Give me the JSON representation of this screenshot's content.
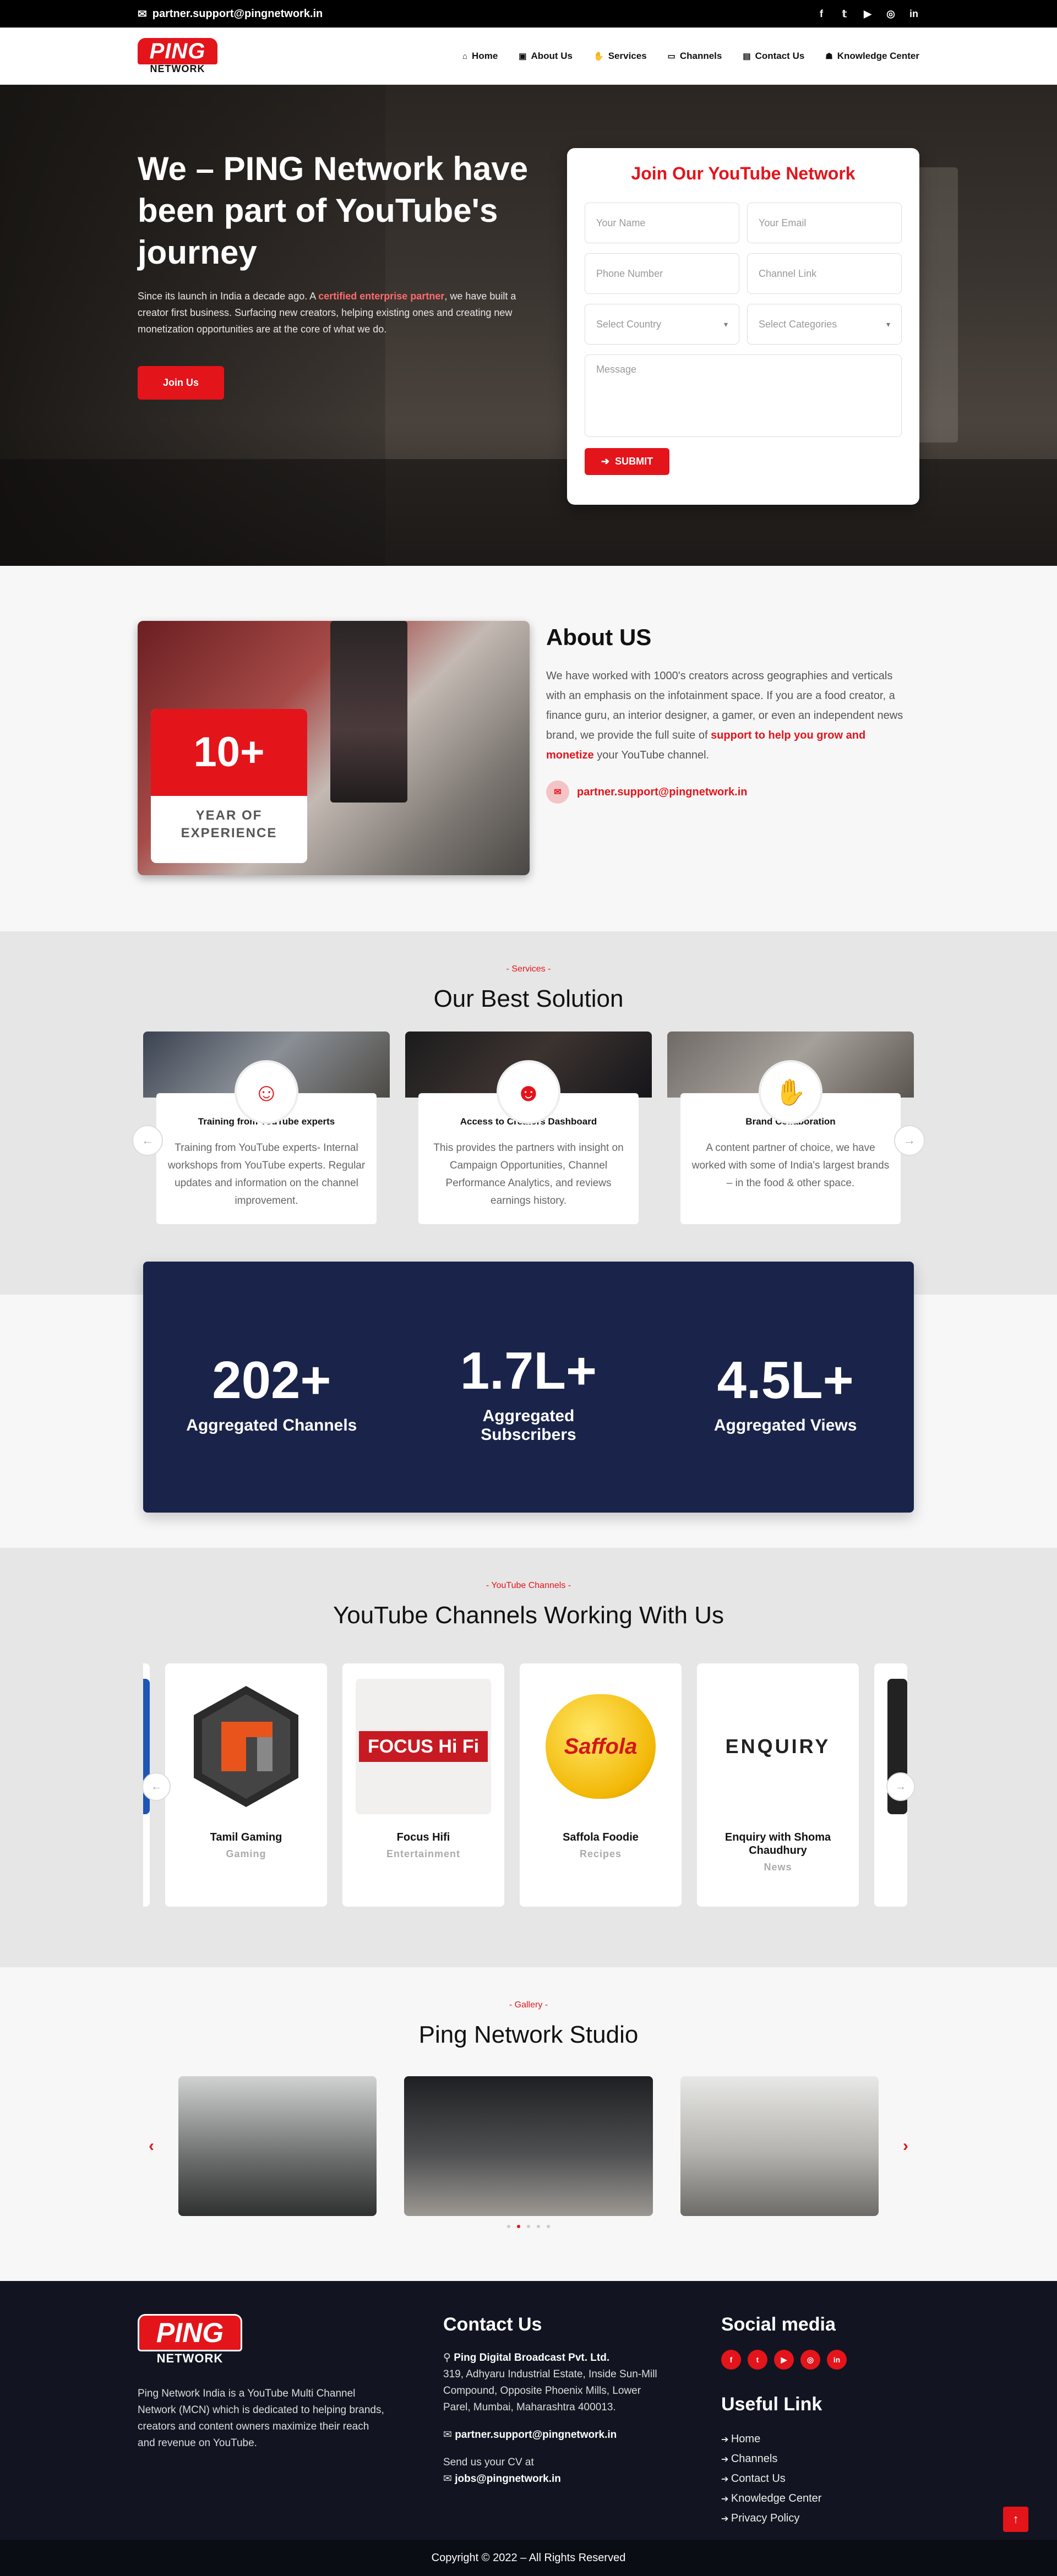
{
  "topbar": {
    "email": "partner.support@pingnetwork.in",
    "social": [
      "f",
      "t",
      "yt",
      "ig",
      "in"
    ]
  },
  "brand": {
    "logo_top": "PING",
    "logo_bottom": "NETWORK",
    "accent": "#e4141b",
    "navy": "#1a2349"
  },
  "nav": {
    "items": [
      {
        "label": "Home",
        "icon": "home-icon"
      },
      {
        "label": "About Us",
        "icon": "id-badge-icon"
      },
      {
        "label": "Services",
        "icon": "handshake-icon"
      },
      {
        "label": "Channels",
        "icon": "monitor-icon"
      },
      {
        "label": "Contact Us",
        "icon": "contact-card-icon"
      },
      {
        "label": "Knowledge Center",
        "icon": "book-user-icon"
      }
    ]
  },
  "hero": {
    "title": "We – PING Network have been part of YouTube's journey",
    "text_before": "Since its launch in India a decade ago. A ",
    "text_highlight": "certified enterprise partner",
    "text_after": ", we have built a creator first business. Surfacing new creators, helping existing ones and creating new monetization opportunities are at the core of what we do.",
    "cta": "Join Us"
  },
  "form": {
    "title": "Join Our YouTube Network",
    "name_placeholder": "Your Name",
    "email_placeholder": "Your Email",
    "phone_placeholder": "Phone Number",
    "channel_placeholder": "Channel Link",
    "country_placeholder": "Select Country",
    "category_placeholder": "Select Categories",
    "message_placeholder": "Message",
    "submit": "SUBMIT"
  },
  "about": {
    "experience_number": "10+",
    "experience_label": "YEAR OF EXPERIENCE",
    "title": "About US",
    "text_before": "We have worked with 1000's creators across geographies and verticals with an emphasis on the infotainment space. If you are a food creator, a finance guru, an interior designer, a gamer, or even an independent news brand, we provide the full suite of ",
    "text_highlight": "support to help you grow and monetize",
    "text_after": " your YouTube channel.",
    "email": "partner.support@pingnetwork.in"
  },
  "services": {
    "tag": "- Services -",
    "title": "Our Best Solution",
    "items": [
      {
        "title": "Training from YouTube experts",
        "text": "Training from YouTube experts- Internal workshops from YouTube experts. Regular updates and information on the channel improvement.",
        "icon": "trainer-icon"
      },
      {
        "title": "Access to Creators Dashboard",
        "text": "This provides the partners with insight on Campaign Opportunities, Channel Performance Analytics, and reviews earnings history.",
        "icon": "creator-dashboard-icon"
      },
      {
        "title": "Brand Collaboration",
        "text": "A content partner of choice, we have worked with some of India's largest brands – in the food & other space.",
        "icon": "collaboration-icon"
      }
    ]
  },
  "stats": [
    {
      "value": "202+",
      "label": "Aggregated Channels"
    },
    {
      "value": "1.7L+",
      "label": "Aggregated Subscribers"
    },
    {
      "value": "4.5L+",
      "label": "Aggregated Views"
    }
  ],
  "channels": {
    "tag": "- YouTube Channels -",
    "title": "YouTube Channels Working With Us",
    "items": [
      {
        "name": "",
        "category": "",
        "logo_text": ""
      },
      {
        "name": "Tamil Gaming",
        "category": "Gaming",
        "logo_text": "TG"
      },
      {
        "name": "Focus Hifi",
        "category": "Entertainment",
        "logo_text": "FOCUS Hi Fi"
      },
      {
        "name": "Saffola Foodie",
        "category": "Recipes",
        "logo_text": "Saffola"
      },
      {
        "name": "Enquiry with Shoma Chaudhury",
        "category": "News",
        "logo_text": "ENQUIRY"
      },
      {
        "name": "",
        "category": "",
        "logo_text": ""
      }
    ]
  },
  "gallery": {
    "tag": "- Gallery -",
    "title": "Ping Network Studio"
  },
  "footer": {
    "about": "Ping Network India is a YouTube Multi Channel Network (MCN) which is dedicated to helping brands, creators and content owners maximize their reach and revenue on YouTube.",
    "contact_title": "Contact Us",
    "company": "Ping Digital Broadcast Pvt. Ltd.",
    "address": "319, Adhyaru Industrial Estate, Inside Sun-Mill Compound, Opposite Phoenix Mills, Lower Parel, Mumbai, Maharashtra 400013.",
    "email": "partner.support@pingnetwork.in",
    "cv_text": "Send us your CV at",
    "jobs_email": "jobs@pingnetwork.in",
    "social_title": "Social media",
    "links_title": "Useful Link",
    "links": [
      "Home",
      "Channels",
      "Contact Us",
      "Knowledge Center",
      "Privacy Policy"
    ],
    "copyright": "Copyright © 2022 – All Rights Reserved"
  }
}
